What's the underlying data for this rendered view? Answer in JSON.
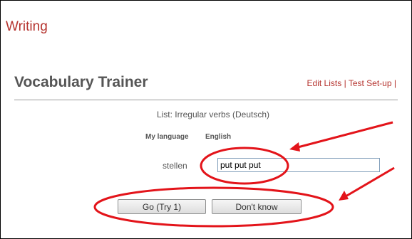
{
  "section_title": "Writing",
  "app_title": "Vocabulary Trainer",
  "links": {
    "edit_lists": "Edit Lists",
    "separator": "|",
    "test_setup": "Test Set-up"
  },
  "list_name": "List: Irregular verbs (Deutsch)",
  "language": {
    "label": "My language",
    "value": "English"
  },
  "question": {
    "word": "stellen",
    "answer_value": "put put put"
  },
  "buttons": {
    "go": "Go (Try 1)",
    "dont_know": "Don't know"
  },
  "colors": {
    "accent": "#b5332e",
    "annotation": "#e3141a"
  }
}
